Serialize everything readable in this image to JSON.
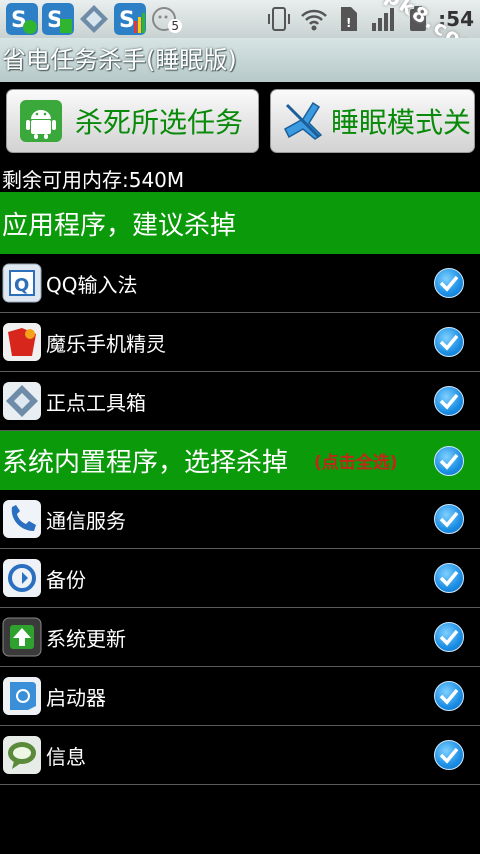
{
  "status_bar": {
    "time": ":54",
    "notif_count": "5",
    "watermark": "apk8.com"
  },
  "app": {
    "title": "省电任务杀手(睡眠版)"
  },
  "buttons": {
    "kill_label": "杀死所选任务",
    "sleep_label": "睡眠模式关"
  },
  "memory_text": "剩余可用内存:540M",
  "sections": {
    "apps": {
      "title": "应用程序，建议杀掉"
    },
    "system": {
      "title": "系统内置程序，选择杀掉",
      "hint": "(点击全选)"
    }
  },
  "app_rows": [
    {
      "name": "QQ输入法",
      "icon": "qq-input-icon",
      "checked": true
    },
    {
      "name": "魔乐手机精灵",
      "icon": "mole-sprite-icon",
      "checked": true
    },
    {
      "name": "正点工具箱",
      "icon": "toolbox-icon",
      "checked": true
    }
  ],
  "system_rows": [
    {
      "name": "通信服务",
      "icon": "phone-icon",
      "checked": true
    },
    {
      "name": "备份",
      "icon": "backup-icon",
      "checked": true
    },
    {
      "name": "系统更新",
      "icon": "system-update-icon",
      "checked": true
    },
    {
      "name": "启动器",
      "icon": "launcher-icon",
      "checked": true
    },
    {
      "name": "信息",
      "icon": "message-icon",
      "checked": true
    }
  ],
  "colors": {
    "accent_green": "#0a9a0a",
    "label_green": "#0a8a0a",
    "hint_red": "#c0281a",
    "check_blue": "#1b8ee4"
  }
}
